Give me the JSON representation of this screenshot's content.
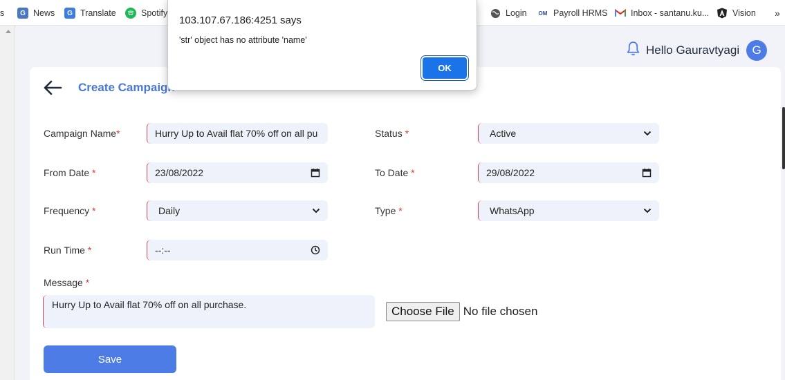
{
  "bookmarks": [
    {
      "label": "s"
    },
    {
      "label": "News"
    },
    {
      "label": "Translate"
    },
    {
      "label": "Spotify"
    },
    {
      "label": "Login"
    },
    {
      "label": "Payroll HRMS"
    },
    {
      "label": "Inbox - santanu.ku..."
    },
    {
      "label": "Vision"
    }
  ],
  "bookmarks_more": "»",
  "header": {
    "greeting": "Hello Gauravtyagi",
    "avatar_initial": "G"
  },
  "page": {
    "title": "Create Campaign"
  },
  "form": {
    "campaign_name_label": "Campaign Name",
    "campaign_name_value": "Hurry Up to Avail flat 70% off on all pu",
    "status_label": "Status",
    "status_value": "Active",
    "from_date_label": "From Date",
    "from_date_value": "23/08/2022",
    "to_date_label": "To Date",
    "to_date_value": "29/08/2022",
    "frequency_label": "Frequency",
    "frequency_value": "Daily",
    "type_label": "Type",
    "type_value": "WhatsApp",
    "run_time_label": "Run Time",
    "run_time_value": "--:--",
    "message_label": "Message",
    "message_value": "Hurry Up to Avail flat 70% off on all purchase.",
    "required_mark": "*",
    "choose_file_label": "Choose File",
    "no_file_text": "No file chosen",
    "save_label": "Save"
  },
  "dialog": {
    "origin": "103.107.67.186:4251 says",
    "message": "'str' object has no attribute 'name'",
    "ok_label": "OK"
  },
  "colors": {
    "accent": "#4e7ce6",
    "title": "#4a78d6",
    "required": "#d63a3a",
    "field_bg": "#eef3fb",
    "dialog_ok": "#1a73e8"
  }
}
